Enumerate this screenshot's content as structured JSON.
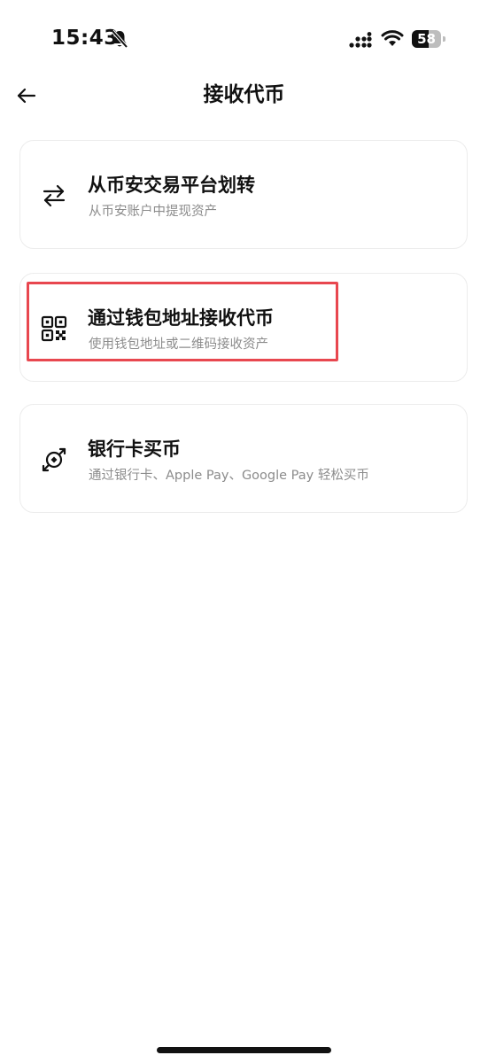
{
  "status_bar": {
    "time": "15:43",
    "battery_level": "58",
    "battery_fraction": 0.58,
    "icons": [
      "bell-slash-icon",
      "signal-icon",
      "wifi-icon",
      "battery-icon"
    ]
  },
  "header": {
    "back_icon": "arrow-left-icon",
    "title": "接收代币"
  },
  "options": [
    {
      "icon": "transfer-arrows-icon",
      "title": "从币安交易平台划转",
      "subtitle": "从币安账户中提现资产"
    },
    {
      "icon": "qr-code-icon",
      "title": "通过钱包地址接收代币",
      "subtitle": "使用钱包地址或二维码接收资产",
      "highlighted": true
    },
    {
      "icon": "buy-crypto-icon",
      "title": "银行卡买币",
      "subtitle": "通过银行卡、Apple Pay、Google Pay 轻松买币"
    }
  ],
  "colors": {
    "highlight_border": "#e8474f",
    "subtitle_text": "#8c8c8c",
    "card_border": "#ececec"
  }
}
